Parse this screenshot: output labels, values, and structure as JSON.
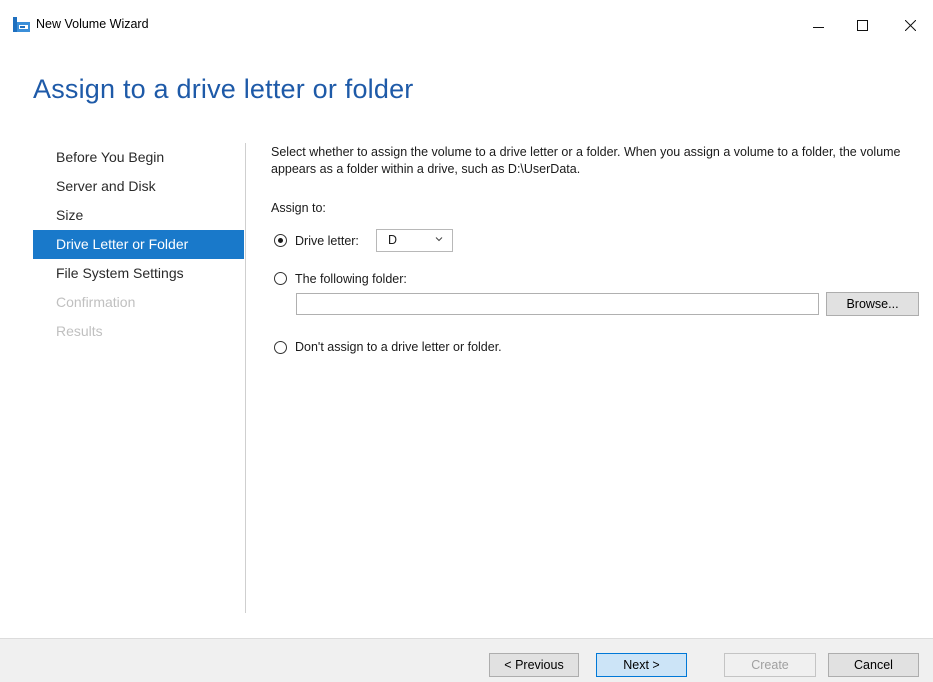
{
  "window": {
    "title": "New Volume Wizard",
    "icon": "volume-wizard-icon",
    "controls": [
      "minimize-icon",
      "maximize-icon",
      "close-icon"
    ]
  },
  "page": {
    "heading": "Assign to a drive letter or folder"
  },
  "nav": {
    "items": [
      {
        "label": "Before You Begin",
        "state": "normal"
      },
      {
        "label": "Server and Disk",
        "state": "normal"
      },
      {
        "label": "Size",
        "state": "normal"
      },
      {
        "label": "Drive Letter or Folder",
        "state": "active"
      },
      {
        "label": "File System Settings",
        "state": "normal"
      },
      {
        "label": "Confirmation",
        "state": "disabled"
      },
      {
        "label": "Results",
        "state": "disabled"
      }
    ]
  },
  "content": {
    "description": "Select whether to assign the volume to a drive letter or a folder. When you assign a volume to a folder, the volume appears as a folder within a drive, such as D:\\UserData.",
    "assign_to_label": "Assign to:",
    "options": {
      "drive_letter": {
        "label": "Drive letter:",
        "selected": true,
        "value": "D"
      },
      "folder": {
        "label": "The following folder:",
        "selected": false,
        "path_value": ""
      },
      "none": {
        "label": "Don't assign to a drive letter or folder.",
        "selected": false
      }
    },
    "browse_label": "Browse..."
  },
  "footer": {
    "previous_label": "< Previous",
    "next_label": "Next >",
    "create_label": "Create",
    "cancel_label": "Cancel"
  },
  "colors": {
    "heading": "#1e5aa8",
    "nav_active_bg": "#1979ca",
    "next_button_bg": "#cce4f7",
    "next_button_border": "#0078d7"
  }
}
